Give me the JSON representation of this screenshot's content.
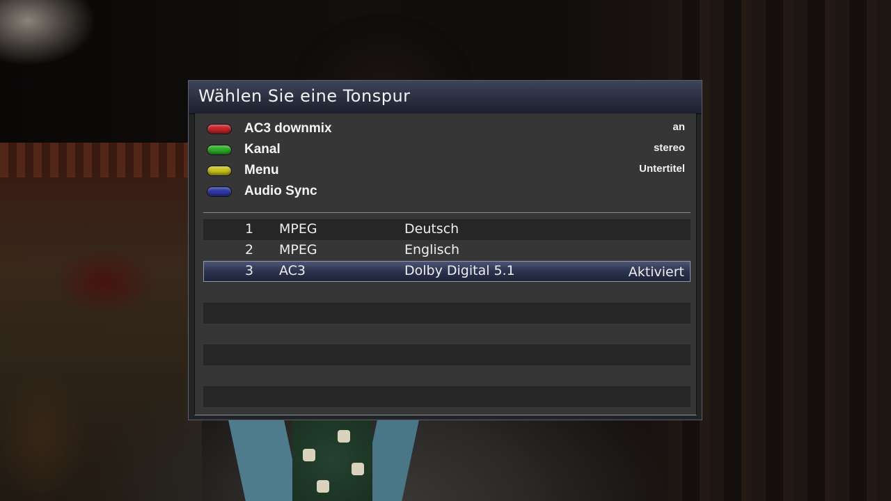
{
  "dialog": {
    "title": "Wählen Sie eine Tonspur"
  },
  "color_buttons": [
    {
      "color": "#c8262c",
      "icon": "red-button-icon",
      "label": "AC3 downmix",
      "value": "an"
    },
    {
      "color": "#2fae2a",
      "icon": "green-button-icon",
      "label": "Kanal",
      "value": "stereo"
    },
    {
      "color": "#c9c21e",
      "icon": "yellow-button-icon",
      "label": "Menu",
      "value": "Untertitel"
    },
    {
      "color": "#2f3aa8",
      "icon": "blue-button-icon",
      "label": "Audio Sync",
      "value": ""
    }
  ],
  "tracks": [
    {
      "number": "1",
      "codec": "MPEG",
      "language": "Deutsch",
      "status": ""
    },
    {
      "number": "2",
      "codec": "MPEG",
      "language": "Englisch",
      "status": ""
    },
    {
      "number": "3",
      "codec": "AC3",
      "language": "Dolby Digital 5.1",
      "status": "Aktiviert"
    }
  ],
  "selected_track_index": 2,
  "colors": {
    "selection": "#2c3350",
    "titlebar": "#2a2f40"
  }
}
